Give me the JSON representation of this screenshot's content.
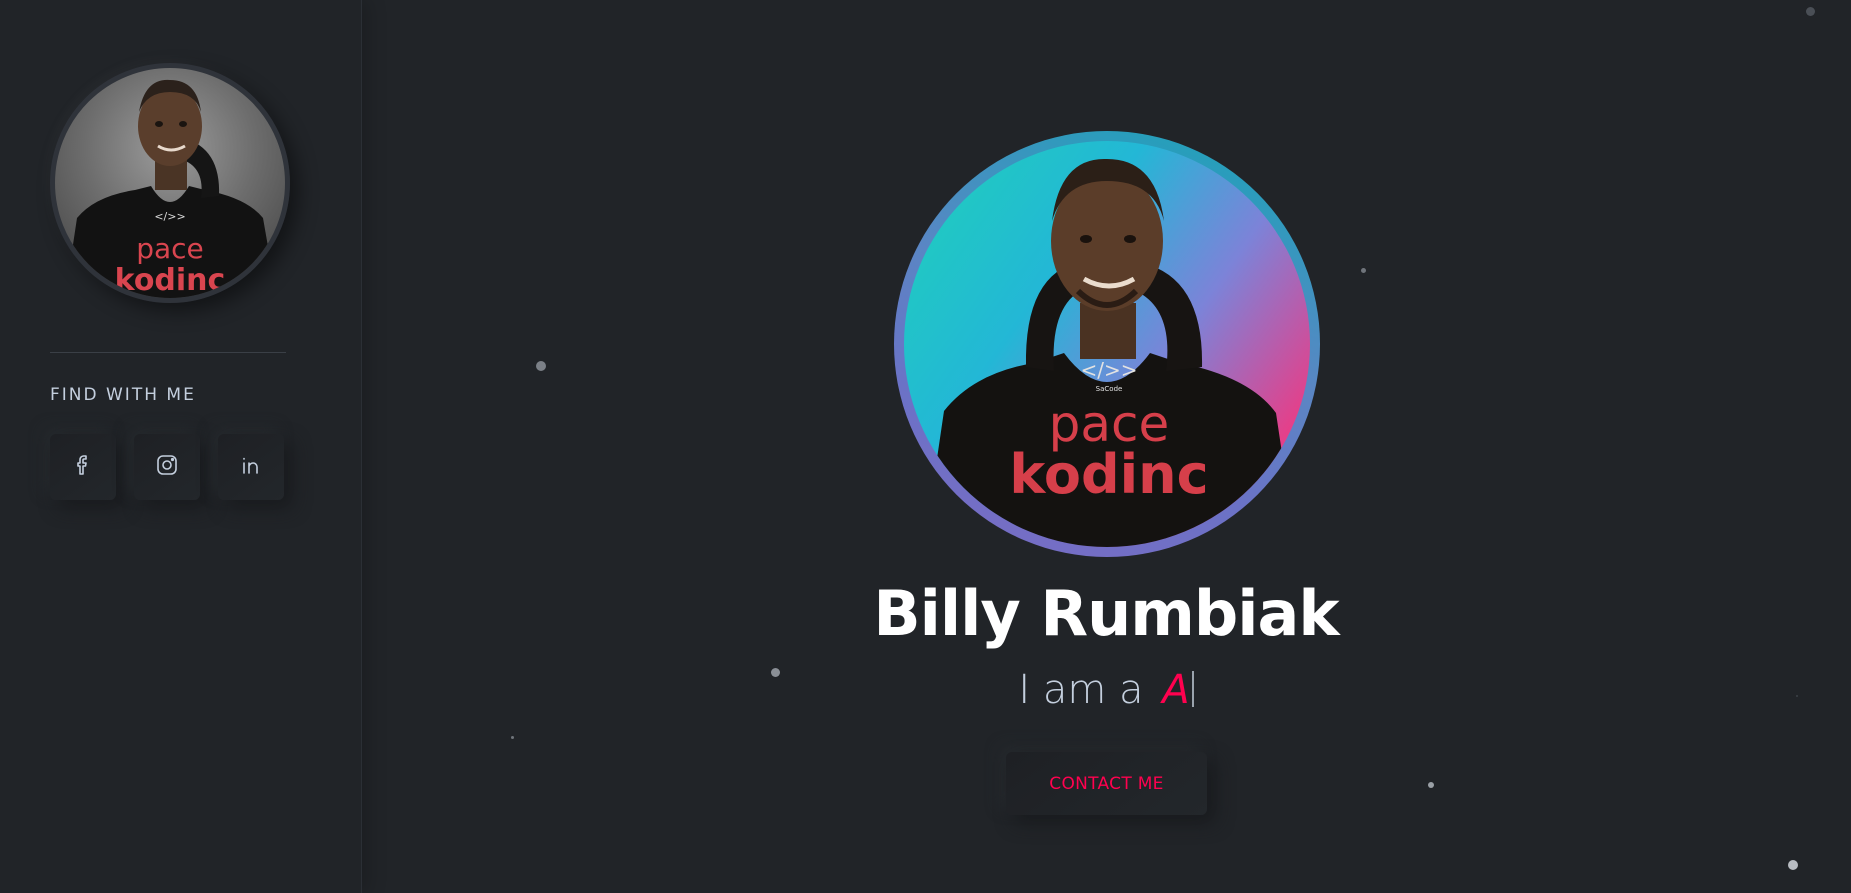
{
  "sidebar": {
    "profile_image_alt": "Billy Rumbiak profile photo",
    "find_title": "FIND WITH ME",
    "social": [
      {
        "icon": "facebook-icon",
        "label": "Facebook"
      },
      {
        "icon": "instagram-icon",
        "label": "Instagram"
      },
      {
        "icon": "linkedin-icon",
        "label": "LinkedIn"
      }
    ]
  },
  "hero": {
    "name": "Billy Rumbiak",
    "tagline_prefix": "I am a",
    "typed_text": "A",
    "contact_label": "CONTACT ME",
    "shirt_text_top": "pace",
    "shirt_text_bottom": "kodinc",
    "shirt_logo": "</>>",
    "shirt_logo_sub": "SaCode"
  },
  "colors": {
    "background": "#212428",
    "accent": "#ff014f",
    "text_muted": "#c4cfde"
  }
}
